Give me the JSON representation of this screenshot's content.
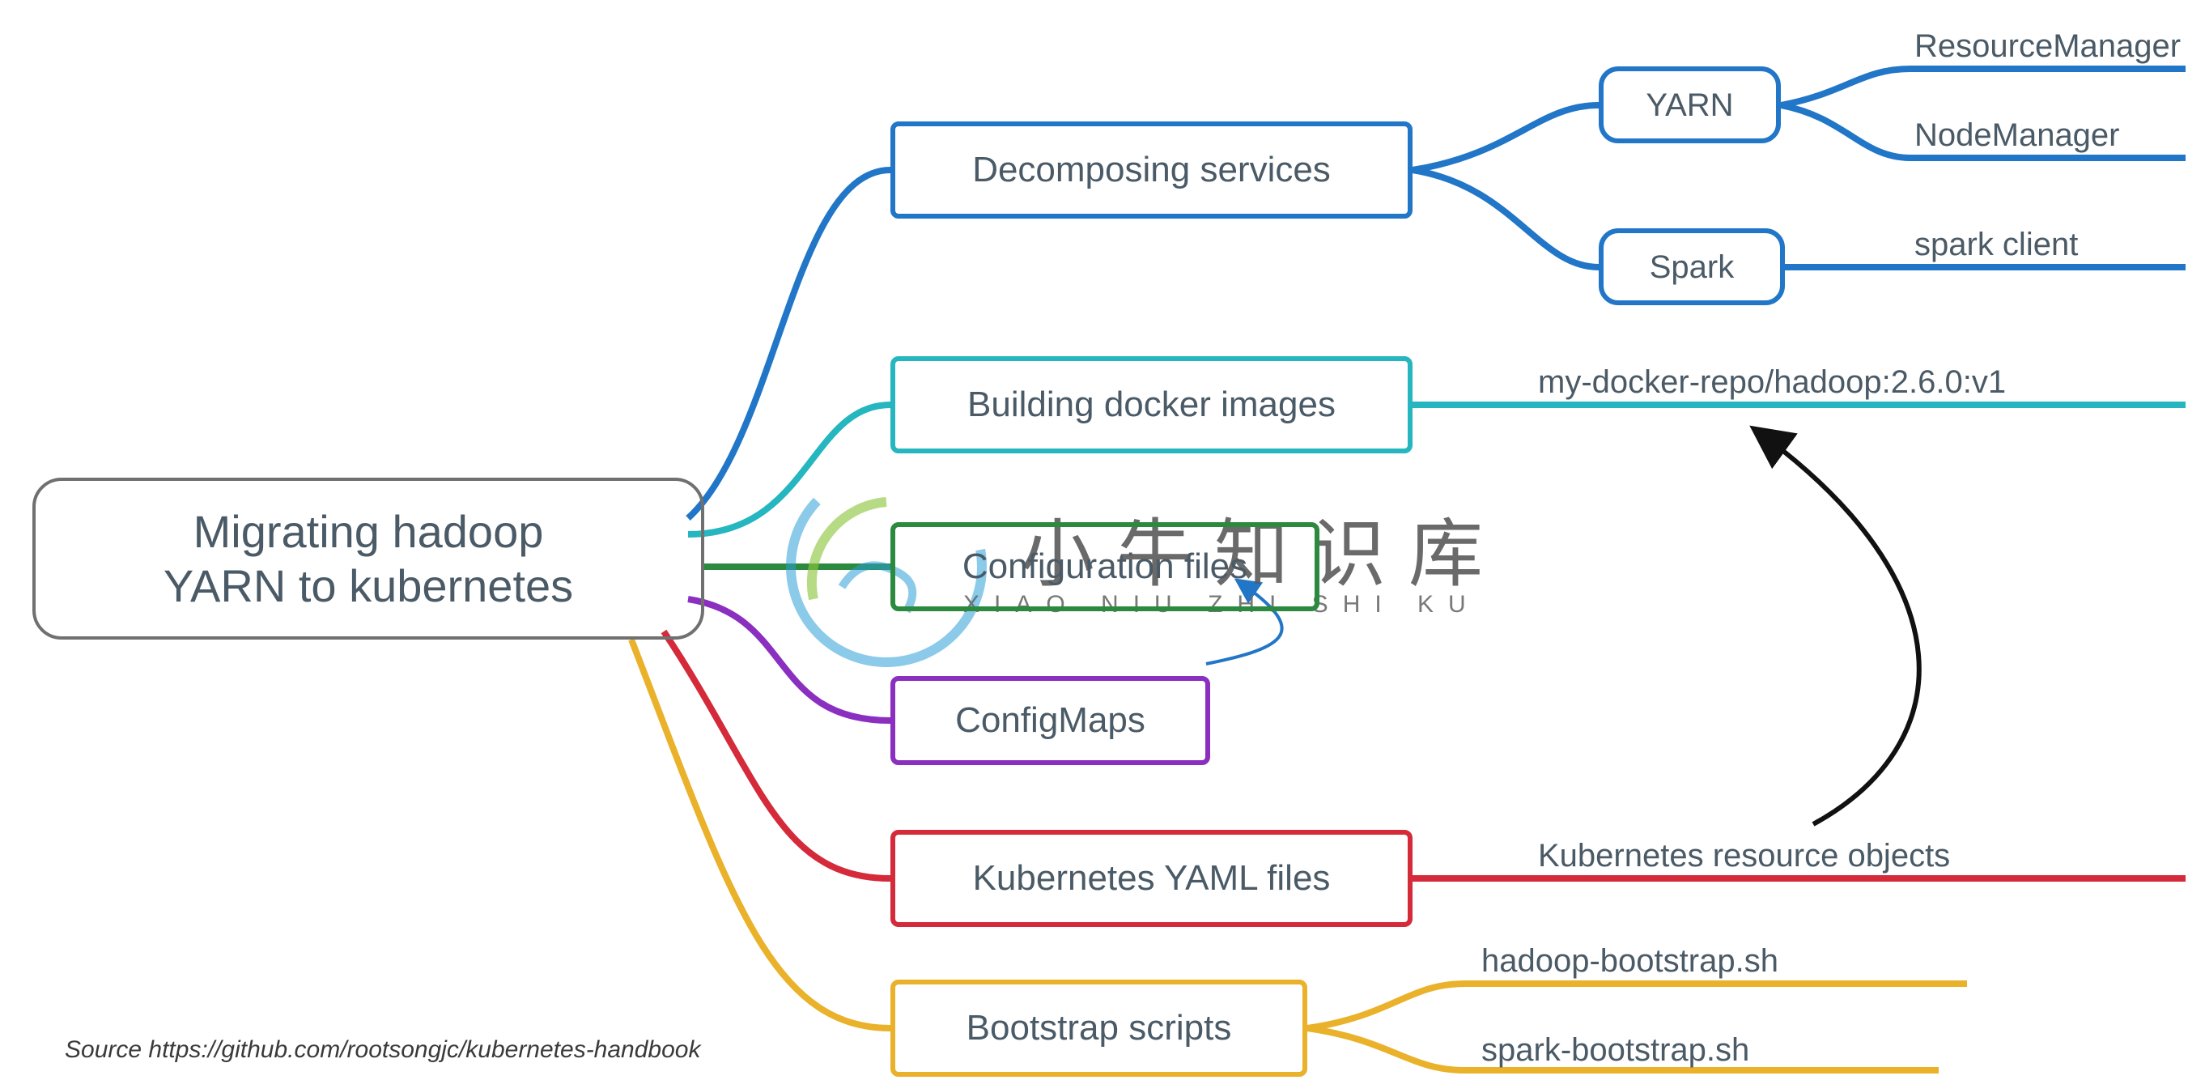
{
  "root": {
    "title_line1": "Migrating hadoop",
    "title_line2": "YARN to kubernetes"
  },
  "branches": {
    "decomposing": {
      "label": "Decomposing services",
      "color": "#2176c7"
    },
    "docker": {
      "label": "Building docker images",
      "color": "#25b6bf"
    },
    "config": {
      "label": "Configuration files",
      "color": "#2b8a3e"
    },
    "configmaps": {
      "label": "ConfigMaps",
      "color": "#8a2fbf"
    },
    "yaml": {
      "label": "Kubernetes YAML files",
      "color": "#d42a3a"
    },
    "bootstrap": {
      "label": "Bootstrap scripts",
      "color": "#eab12a"
    }
  },
  "decomposing_children": {
    "yarn": {
      "label": "YARN"
    },
    "spark": {
      "label": "Spark"
    }
  },
  "leaves": {
    "resource_manager": "ResourceManager",
    "node_manager": "NodeManager",
    "spark_client": "spark client",
    "docker_image": "my-docker-repo/hadoop:2.6.0:v1",
    "k8s_objects": "Kubernetes resource objects",
    "hadoop_sh": "hadoop-bootstrap.sh",
    "spark_sh": "spark-bootstrap.sh"
  },
  "source": "Source https://github.com/rootsongjc/kubernetes-handbook",
  "watermark": {
    "cn": "小牛知识库",
    "en": "XIAO NIU ZHI SHI KU"
  },
  "colors": {
    "blue": "#2176c7",
    "teal": "#25b6bf",
    "green": "#2b8a3e",
    "purple": "#8a2fbf",
    "red": "#d42a3a",
    "amber": "#eab12a",
    "black": "#111111"
  }
}
